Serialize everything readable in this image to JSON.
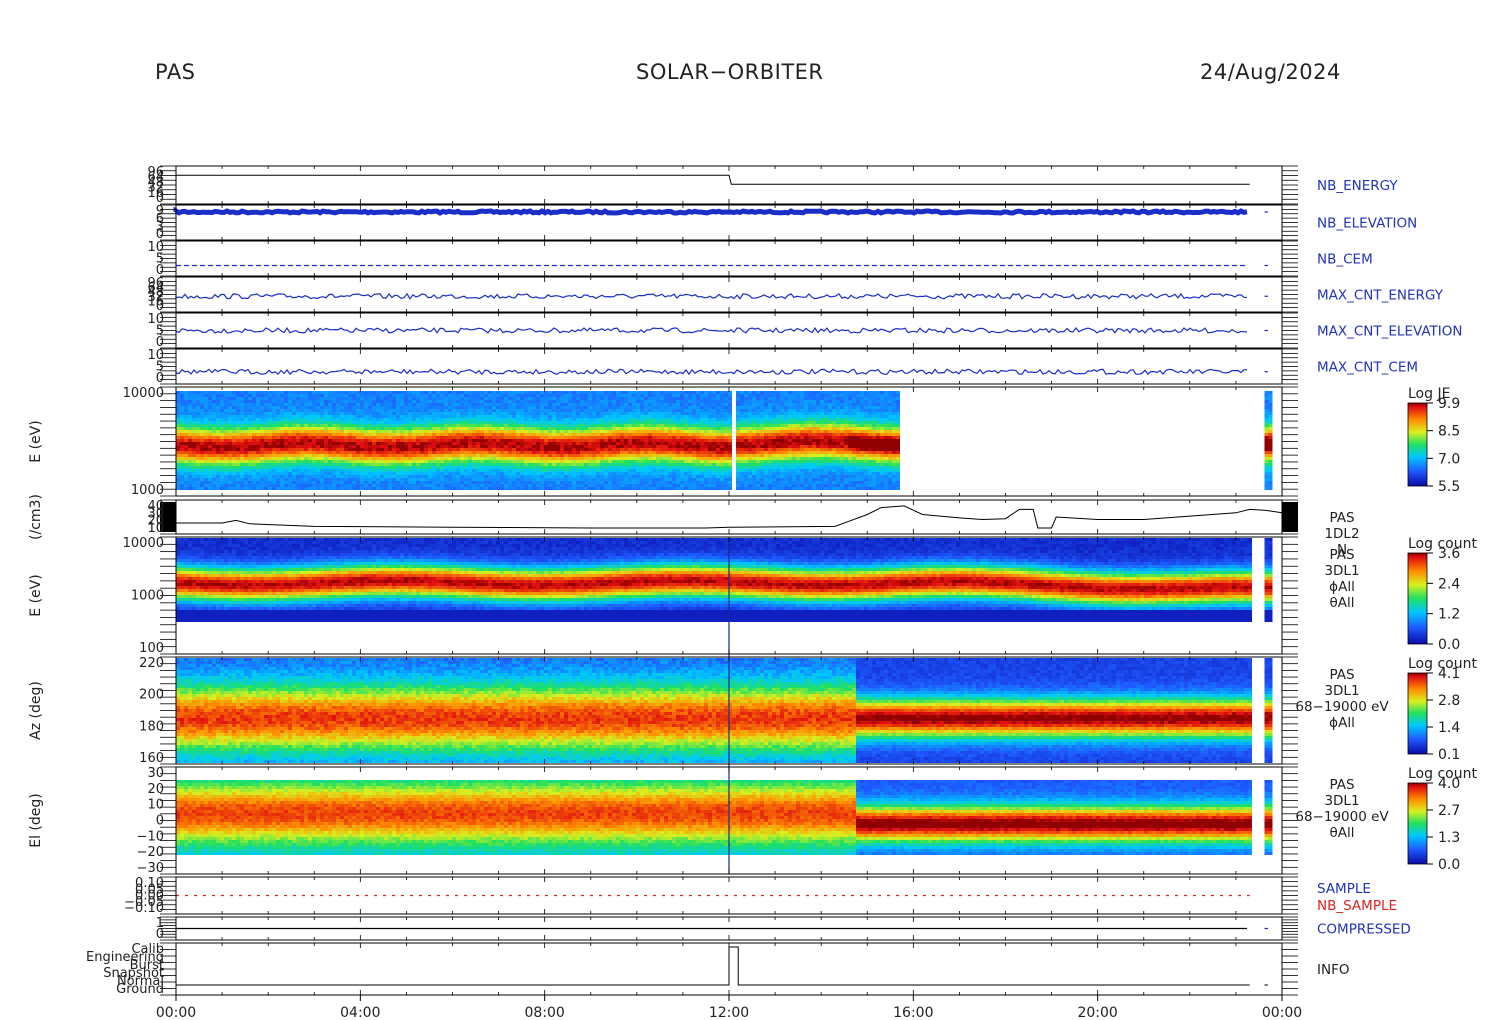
{
  "header": {
    "left": "PAS",
    "center": "SOLAR−ORBITER",
    "right": "24/Aug/2024"
  },
  "chart_data": {
    "type": "line",
    "x_ticks": [
      "00:00",
      "04:00",
      "08:00",
      "12:00",
      "16:00",
      "20:00",
      "00:00"
    ],
    "x_range_hours": [
      0,
      24
    ],
    "data_end_hour": 23.3,
    "data_resume_hour": 23.62,
    "panels": [
      {
        "id": "nb_energy",
        "label": "NB_ENERGY",
        "label_color": "#2233bb",
        "type": "line",
        "ytick_labels": [
          "96",
          "64",
          "48",
          "32",
          "16",
          "0"
        ],
        "data": [
          [
            0,
            1
          ],
          [
            12,
            1
          ],
          [
            12.05,
            0.6
          ],
          [
            23.3,
            0.6
          ]
        ]
      },
      {
        "id": "nb_elevation",
        "label": "NB_ELEVATION",
        "label_color": "#2233bb",
        "type": "line",
        "ytick_labels": [
          "9",
          "6",
          "3",
          "0"
        ],
        "level": 0.8,
        "pattern": "comb"
      },
      {
        "id": "nb_cem",
        "label": "NB_CEM",
        "label_color": "#2233bb",
        "type": "line",
        "ytick_labels": [
          "10",
          "5",
          "0"
        ],
        "level": 0.3,
        "pattern": "dashed"
      },
      {
        "id": "max_cnt_energy",
        "label": "MAX_CNT_ENERGY",
        "label_color": "#2233bb",
        "type": "line",
        "ytick_labels": [
          "96",
          "64",
          "48",
          "32",
          "16",
          "0"
        ],
        "level": 0.45,
        "pattern": "noisy"
      },
      {
        "id": "max_cnt_elevation",
        "label": "MAX_CNT_ELEVATION",
        "label_color": "#2233bb",
        "type": "line",
        "ytick_labels": [
          "10",
          "5",
          "0"
        ],
        "level": 0.5,
        "pattern": "noisy"
      },
      {
        "id": "max_cnt_cem",
        "label": "MAX_CNT_CEM",
        "label_color": "#2233bb",
        "type": "line",
        "ytick_labels": [
          "10",
          "5",
          "0"
        ],
        "level": 0.35,
        "pattern": "noisy"
      },
      {
        "id": "pas_je",
        "type": "spectrogram",
        "ylabel": "E (eV)",
        "ytick_labels": [
          "10000",
          "1000"
        ],
        "ylog": true,
        "yrange": [
          320,
          20000
        ],
        "colorbar": {
          "title": "Log JE",
          "ticks": [
            "9.9",
            "8.5",
            "7.0",
            "5.5"
          ]
        },
        "data_end_hour": 15.7
      },
      {
        "id": "density",
        "type": "line",
        "ylabel": "(/cm3)",
        "ytick_labels": [
          "40",
          "30",
          "20",
          "10"
        ],
        "yrange": [
          5,
          45
        ],
        "label_lines": [
          "PAS",
          "1DL2",
          "N"
        ],
        "values": [
          [
            0,
            18
          ],
          [
            1,
            18
          ],
          [
            1.3,
            21
          ],
          [
            1.6,
            17
          ],
          [
            3,
            14
          ],
          [
            6,
            13
          ],
          [
            9,
            12
          ],
          [
            11.5,
            12
          ],
          [
            12,
            13
          ],
          [
            14.3,
            14
          ],
          [
            14.6,
            20
          ],
          [
            15,
            28
          ],
          [
            15.3,
            36
          ],
          [
            15.8,
            38
          ],
          [
            16.2,
            28
          ],
          [
            17,
            24
          ],
          [
            17.5,
            22
          ],
          [
            18,
            23
          ],
          [
            18.3,
            34
          ],
          [
            18.6,
            34
          ],
          [
            18.7,
            12
          ],
          [
            19,
            12
          ],
          [
            19.1,
            25
          ],
          [
            20,
            22
          ],
          [
            21,
            22
          ],
          [
            22,
            26
          ],
          [
            23,
            30
          ],
          [
            23.3,
            34
          ],
          [
            23.62,
            33
          ],
          [
            24,
            30
          ]
        ]
      },
      {
        "id": "pas_3dl1_e",
        "type": "spectrogram",
        "ylabel": "E (eV)",
        "ytick_labels": [
          "10000",
          "1000",
          "100"
        ],
        "ylog": true,
        "yrange": [
          70,
          15000
        ],
        "label_lines": [
          "PAS",
          "3DL1",
          "ϕAll",
          "θAll"
        ],
        "colorbar": {
          "title": "Log count",
          "ticks": [
            "3.6",
            "2.4",
            "1.2",
            "0.0"
          ]
        }
      },
      {
        "id": "pas_3dl1_az",
        "type": "spectrogram",
        "ylabel": "Az (deg)",
        "ytick_labels": [
          "220",
          "200",
          "180",
          "160"
        ],
        "yrange": [
          150,
          225
        ],
        "label_lines": [
          "PAS",
          "3DL1",
          "68−19000 eV",
          "ϕAll"
        ],
        "colorbar": {
          "title": "Log count",
          "ticks": [
            "4.1",
            "2.8",
            "1.4",
            "0.1"
          ]
        }
      },
      {
        "id": "pas_3dl1_el",
        "type": "spectrogram",
        "ylabel": "El (deg)",
        "ytick_labels": [
          "30",
          "20",
          "10",
          "0",
          "−10",
          "−20",
          "−30"
        ],
        "yrange": [
          -30,
          30
        ],
        "label_lines": [
          "PAS",
          "3DL1",
          "68−19000 eV",
          "θAll"
        ],
        "colorbar": {
          "title": "Log count",
          "ticks": [
            "4.0",
            "2.7",
            "1.3",
            "0.0"
          ]
        }
      },
      {
        "id": "sample",
        "type": "line",
        "ytick_labels": [
          "0.10",
          "0.05",
          "0.00",
          "−0.05",
          "−0.10"
        ],
        "labels": [
          {
            "text": "SAMPLE",
            "color": "#2233bb"
          },
          {
            "text": "NB_SAMPLE",
            "color": "#dd2222"
          }
        ]
      },
      {
        "id": "compressed",
        "label": "COMPRESSED",
        "label_color": "#2233bb",
        "type": "line",
        "ytick_labels": [
          "1",
          "0"
        ],
        "level": 0.5
      },
      {
        "id": "info",
        "label": "INFO",
        "label_color": "#222222",
        "type": "line",
        "ytick_labels": [
          "Calib",
          "Engineering",
          "Burst",
          "Snapshot",
          "Normal",
          "Ground"
        ]
      }
    ]
  }
}
